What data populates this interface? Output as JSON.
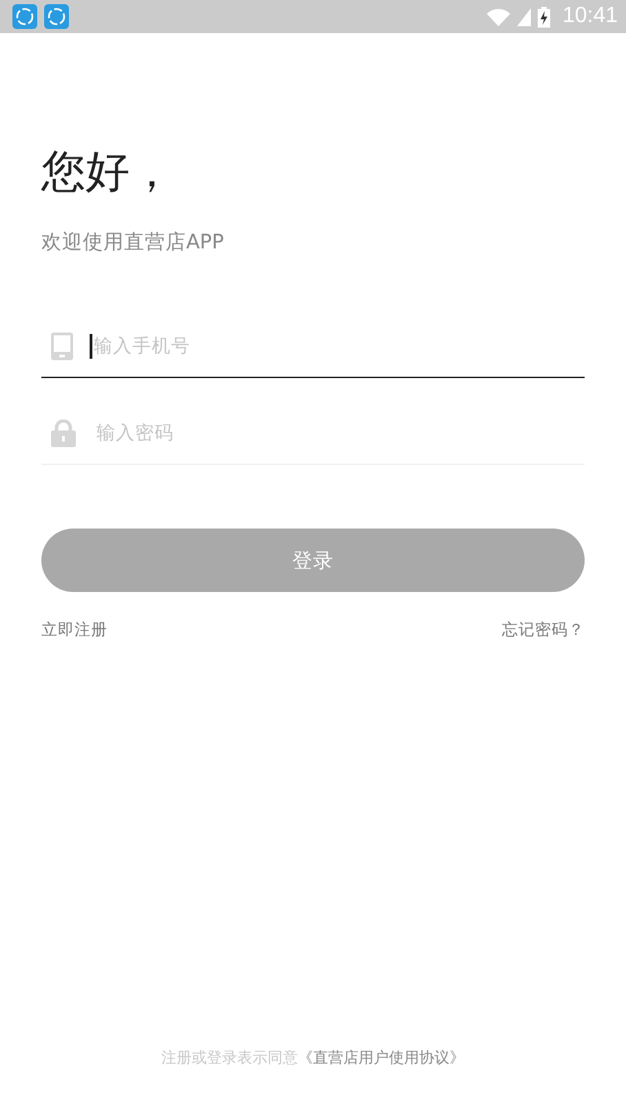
{
  "status_bar": {
    "time": "10:41",
    "notifications": [
      {
        "kind": "app"
      },
      {
        "kind": "app"
      }
    ]
  },
  "greeting": "您好，",
  "subtitle": "欢迎使用直营店APP",
  "fields": [
    {
      "kind": "phone",
      "placeholder": "输入手机号",
      "focused": true
    },
    {
      "kind": "password",
      "placeholder": "输入密码",
      "focused": false
    }
  ],
  "login_button": "登录",
  "register_link": "立即注册",
  "forgot_link": "忘记密码？",
  "agreement": {
    "text": "注册或登录表示同意",
    "link": "《直营店用户使用协议》"
  }
}
